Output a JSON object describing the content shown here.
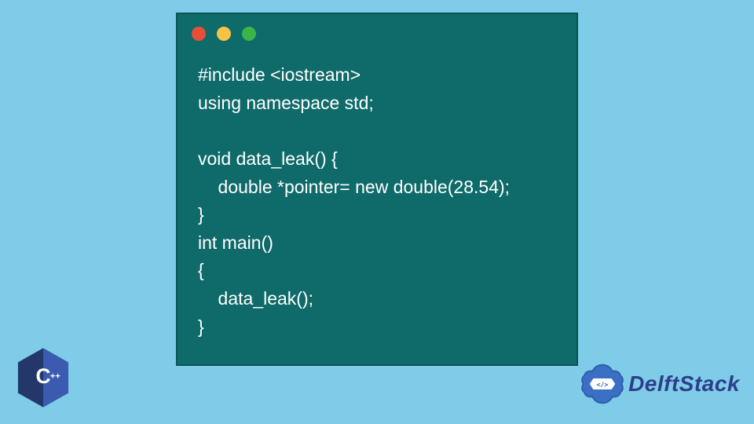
{
  "code": {
    "lines": [
      "#include <iostream>",
      "using namespace std;",
      "",
      "void data_leak() {",
      "    double *pointer= new double(28.54);",
      "}",
      "int main()",
      "{",
      "    data_leak();",
      "}"
    ]
  },
  "brand": {
    "name": "DelftStack"
  },
  "badge": {
    "label": "C++"
  },
  "colors": {
    "page_bg": "#7ecce8",
    "card_bg": "#0f6a6a",
    "dot_red": "#e94f37",
    "dot_yellow": "#f6c343",
    "dot_green": "#3bb44a",
    "brand_text": "#2e3e8a"
  }
}
